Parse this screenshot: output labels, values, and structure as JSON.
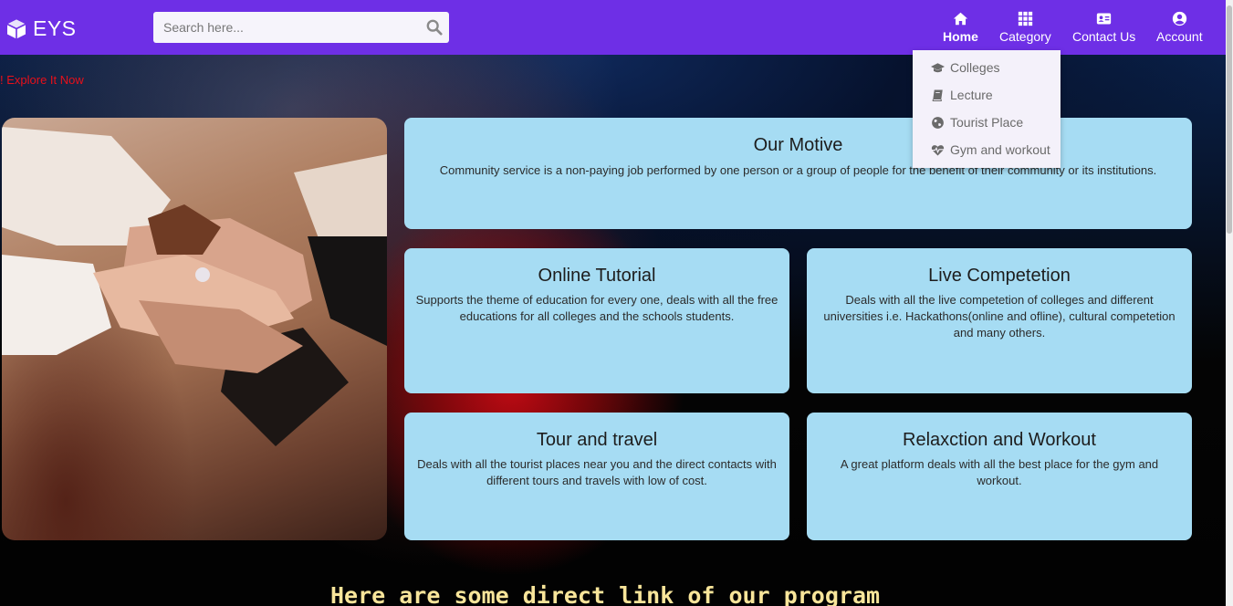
{
  "brand": {
    "name": "EYS"
  },
  "search": {
    "placeholder": "Search here..."
  },
  "nav": [
    {
      "label": "Home",
      "icon": "home-icon"
    },
    {
      "label": "Category",
      "icon": "grid-icon"
    },
    {
      "label": "Contact Us",
      "icon": "contact-card-icon"
    },
    {
      "label": "Account",
      "icon": "user-circle-icon"
    }
  ],
  "dropdown": [
    {
      "label": "Colleges",
      "icon": "graduation-cap-icon"
    },
    {
      "label": "Lecture",
      "icon": "book-icon"
    },
    {
      "label": "Tourist Place",
      "icon": "globe-icon"
    },
    {
      "label": "Gym and workout",
      "icon": "heartbeat-icon"
    }
  ],
  "marquee": {
    "text": "! Explore It Now"
  },
  "cards": {
    "motive": {
      "title": "Our Motive",
      "text": "Community service is a non-paying job performed by one person or a group of people for the benefit of their community or its institutions."
    },
    "tutorial": {
      "title": "Online Tutorial",
      "text": "Supports the theme of education for every one, deals with all the free educations for all colleges and the schools students."
    },
    "competition": {
      "title": "Live Competetion",
      "text": "Deals with all the live competetion of colleges and different universities i.e. Hackathons(online and ofline), cultural competetion and many others."
    },
    "travel": {
      "title": "Tour and travel",
      "text": "Deals with all the tourist places near you and the direct contacts with different tours and travels with low of cost."
    },
    "workout": {
      "title": "Relaxction and Workout",
      "text": "A great platform deals with all the best place for the gym and workout."
    }
  },
  "program_heading": "Here are some direct link of our program",
  "colors": {
    "navbar": "#6e2fe6",
    "card": "#a6dcf3",
    "marquee": "#e8101a",
    "heading": "#f8e59a"
  }
}
